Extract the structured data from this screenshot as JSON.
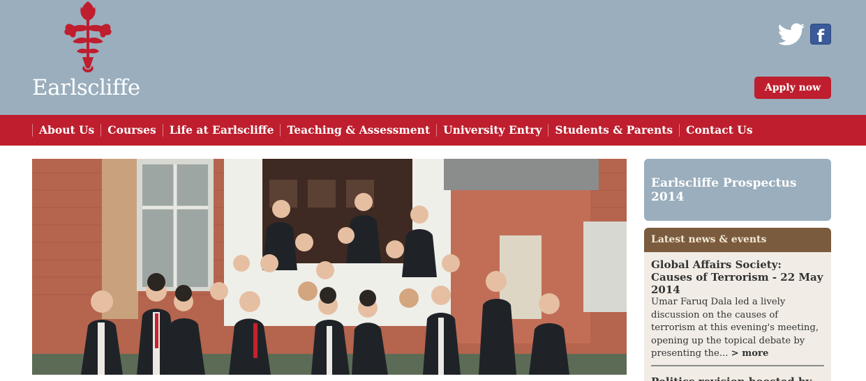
{
  "brand": {
    "name": "Earlscliffe"
  },
  "header": {
    "apply_label": "Apply now",
    "facebook_glyph": "f"
  },
  "nav": {
    "items": [
      {
        "label": "About Us"
      },
      {
        "label": "Courses"
      },
      {
        "label": "Life at Earlscliffe"
      },
      {
        "label": "Teaching & Assessment"
      },
      {
        "label": "University Entry"
      },
      {
        "label": "Students & Parents"
      },
      {
        "label": "Contact Us"
      }
    ]
  },
  "sidebar": {
    "prospectus_label": "Earlscliffe Prospectus 2014",
    "news_heading": "Latest news & events",
    "news": [
      {
        "title": "Global Affairs Society: Causes of Terrorism - 22 May 2014",
        "excerpt": "Umar Faruq Dala led a lively discussion on the causes of terrorism at this evening's meeting, opening up the topical debate by presenting the... ",
        "more": "> more"
      },
      {
        "title": "Politics revision boosted by"
      }
    ]
  },
  "colors": {
    "header_bg": "#9aaebd",
    "brand_red": "#be1e2d",
    "news_header": "#7b5b3e",
    "news_bg": "#f1ede6"
  }
}
